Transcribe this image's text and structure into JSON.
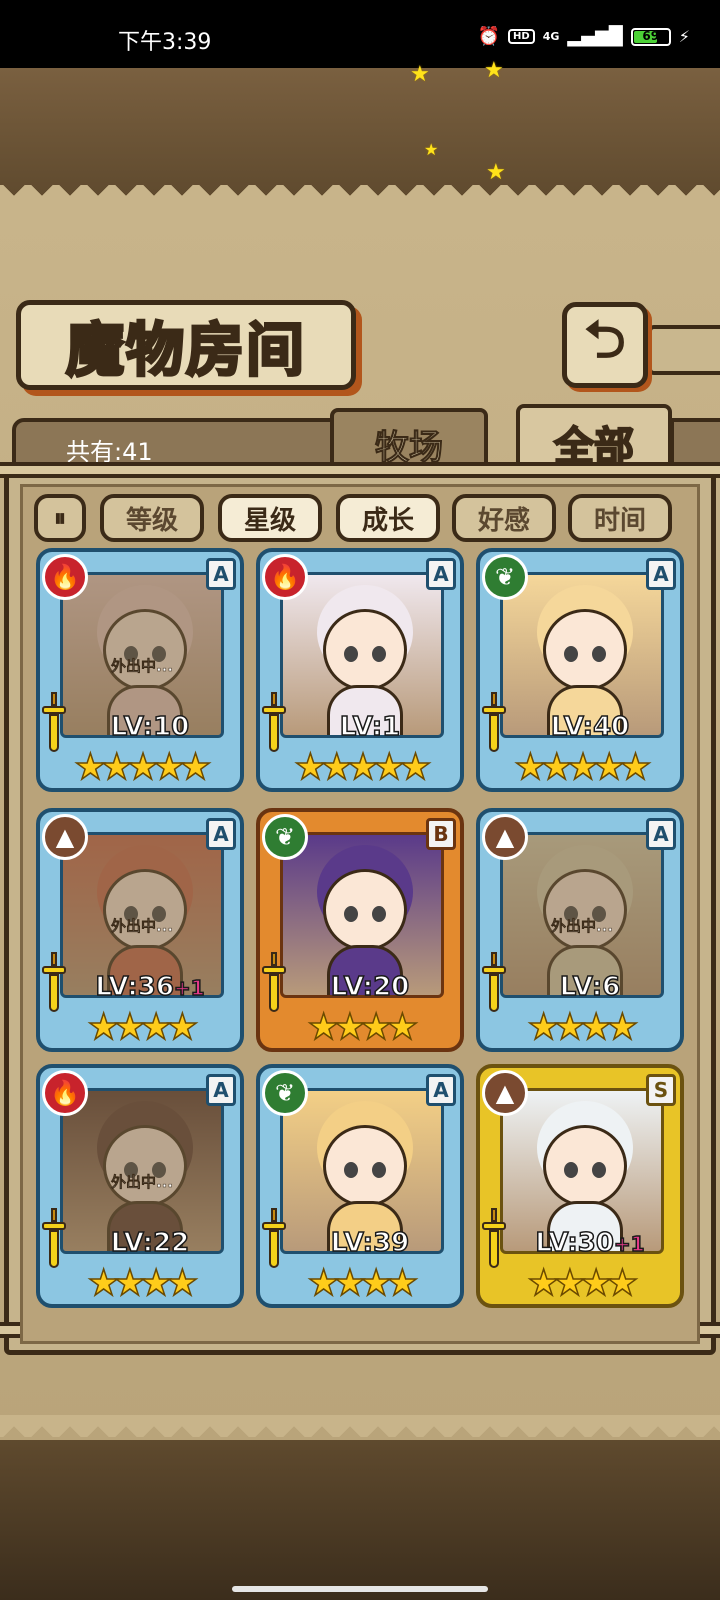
{
  "status_bar": {
    "time": "下午3:39",
    "hd": "HD",
    "network": "4G",
    "battery": 69,
    "battery_text": "69"
  },
  "title": "魔物房间",
  "count_label": "共有:41",
  "tabs": [
    {
      "label": "牧场",
      "active": false
    },
    {
      "label": "全部",
      "active": true
    }
  ],
  "sort_toggle_icon": "sort-order-icon",
  "sort_buttons": [
    {
      "label": "等级",
      "active": false
    },
    {
      "label": "星级",
      "active": true
    },
    {
      "label": "成长",
      "active": true
    },
    {
      "label": "好感",
      "active": false
    },
    {
      "label": "时间",
      "active": false
    }
  ],
  "monsters": [
    {
      "element": "fire",
      "rank": "A",
      "level": "LV:10",
      "bonus": "",
      "stars": 5,
      "away": "外出中...",
      "frame": "blue",
      "palette": "#e8c8c0"
    },
    {
      "element": "fire",
      "rank": "A",
      "level": "LV:1",
      "bonus": "",
      "stars": 5,
      "away": "",
      "frame": "blue",
      "palette": "#f0e8ee"
    },
    {
      "element": "leaf",
      "rank": "A",
      "level": "LV:40",
      "bonus": "",
      "stars": 5,
      "away": "",
      "frame": "blue",
      "palette": "#f5d79a"
    },
    {
      "element": "rock",
      "rank": "A",
      "level": "LV:36",
      "bonus": "+1",
      "stars": 4,
      "away": "外出中...",
      "frame": "blue",
      "palette": "#c9664a"
    },
    {
      "element": "leaf",
      "rank": "B",
      "level": "LV:20",
      "bonus": "",
      "stars": 4,
      "away": "",
      "frame": "orange",
      "palette": "#5a3a8a"
    },
    {
      "element": "rock",
      "rank": "A",
      "level": "LV:6",
      "bonus": "",
      "stars": 4,
      "away": "外出中...",
      "frame": "blue",
      "palette": "#d8d0b0"
    },
    {
      "element": "fire",
      "rank": "A",
      "level": "LV:22",
      "bonus": "",
      "stars": 4,
      "away": "外出中...",
      "frame": "blue",
      "palette": "#5a3a30"
    },
    {
      "element": "leaf",
      "rank": "A",
      "level": "LV:39",
      "bonus": "",
      "stars": 4,
      "away": "",
      "frame": "blue",
      "palette": "#f3cf86"
    },
    {
      "element": "rock",
      "rank": "S",
      "level": "LV:30",
      "bonus": "+1",
      "stars": 4,
      "away": "",
      "frame": "gold",
      "palette": "#eef2f4"
    }
  ]
}
